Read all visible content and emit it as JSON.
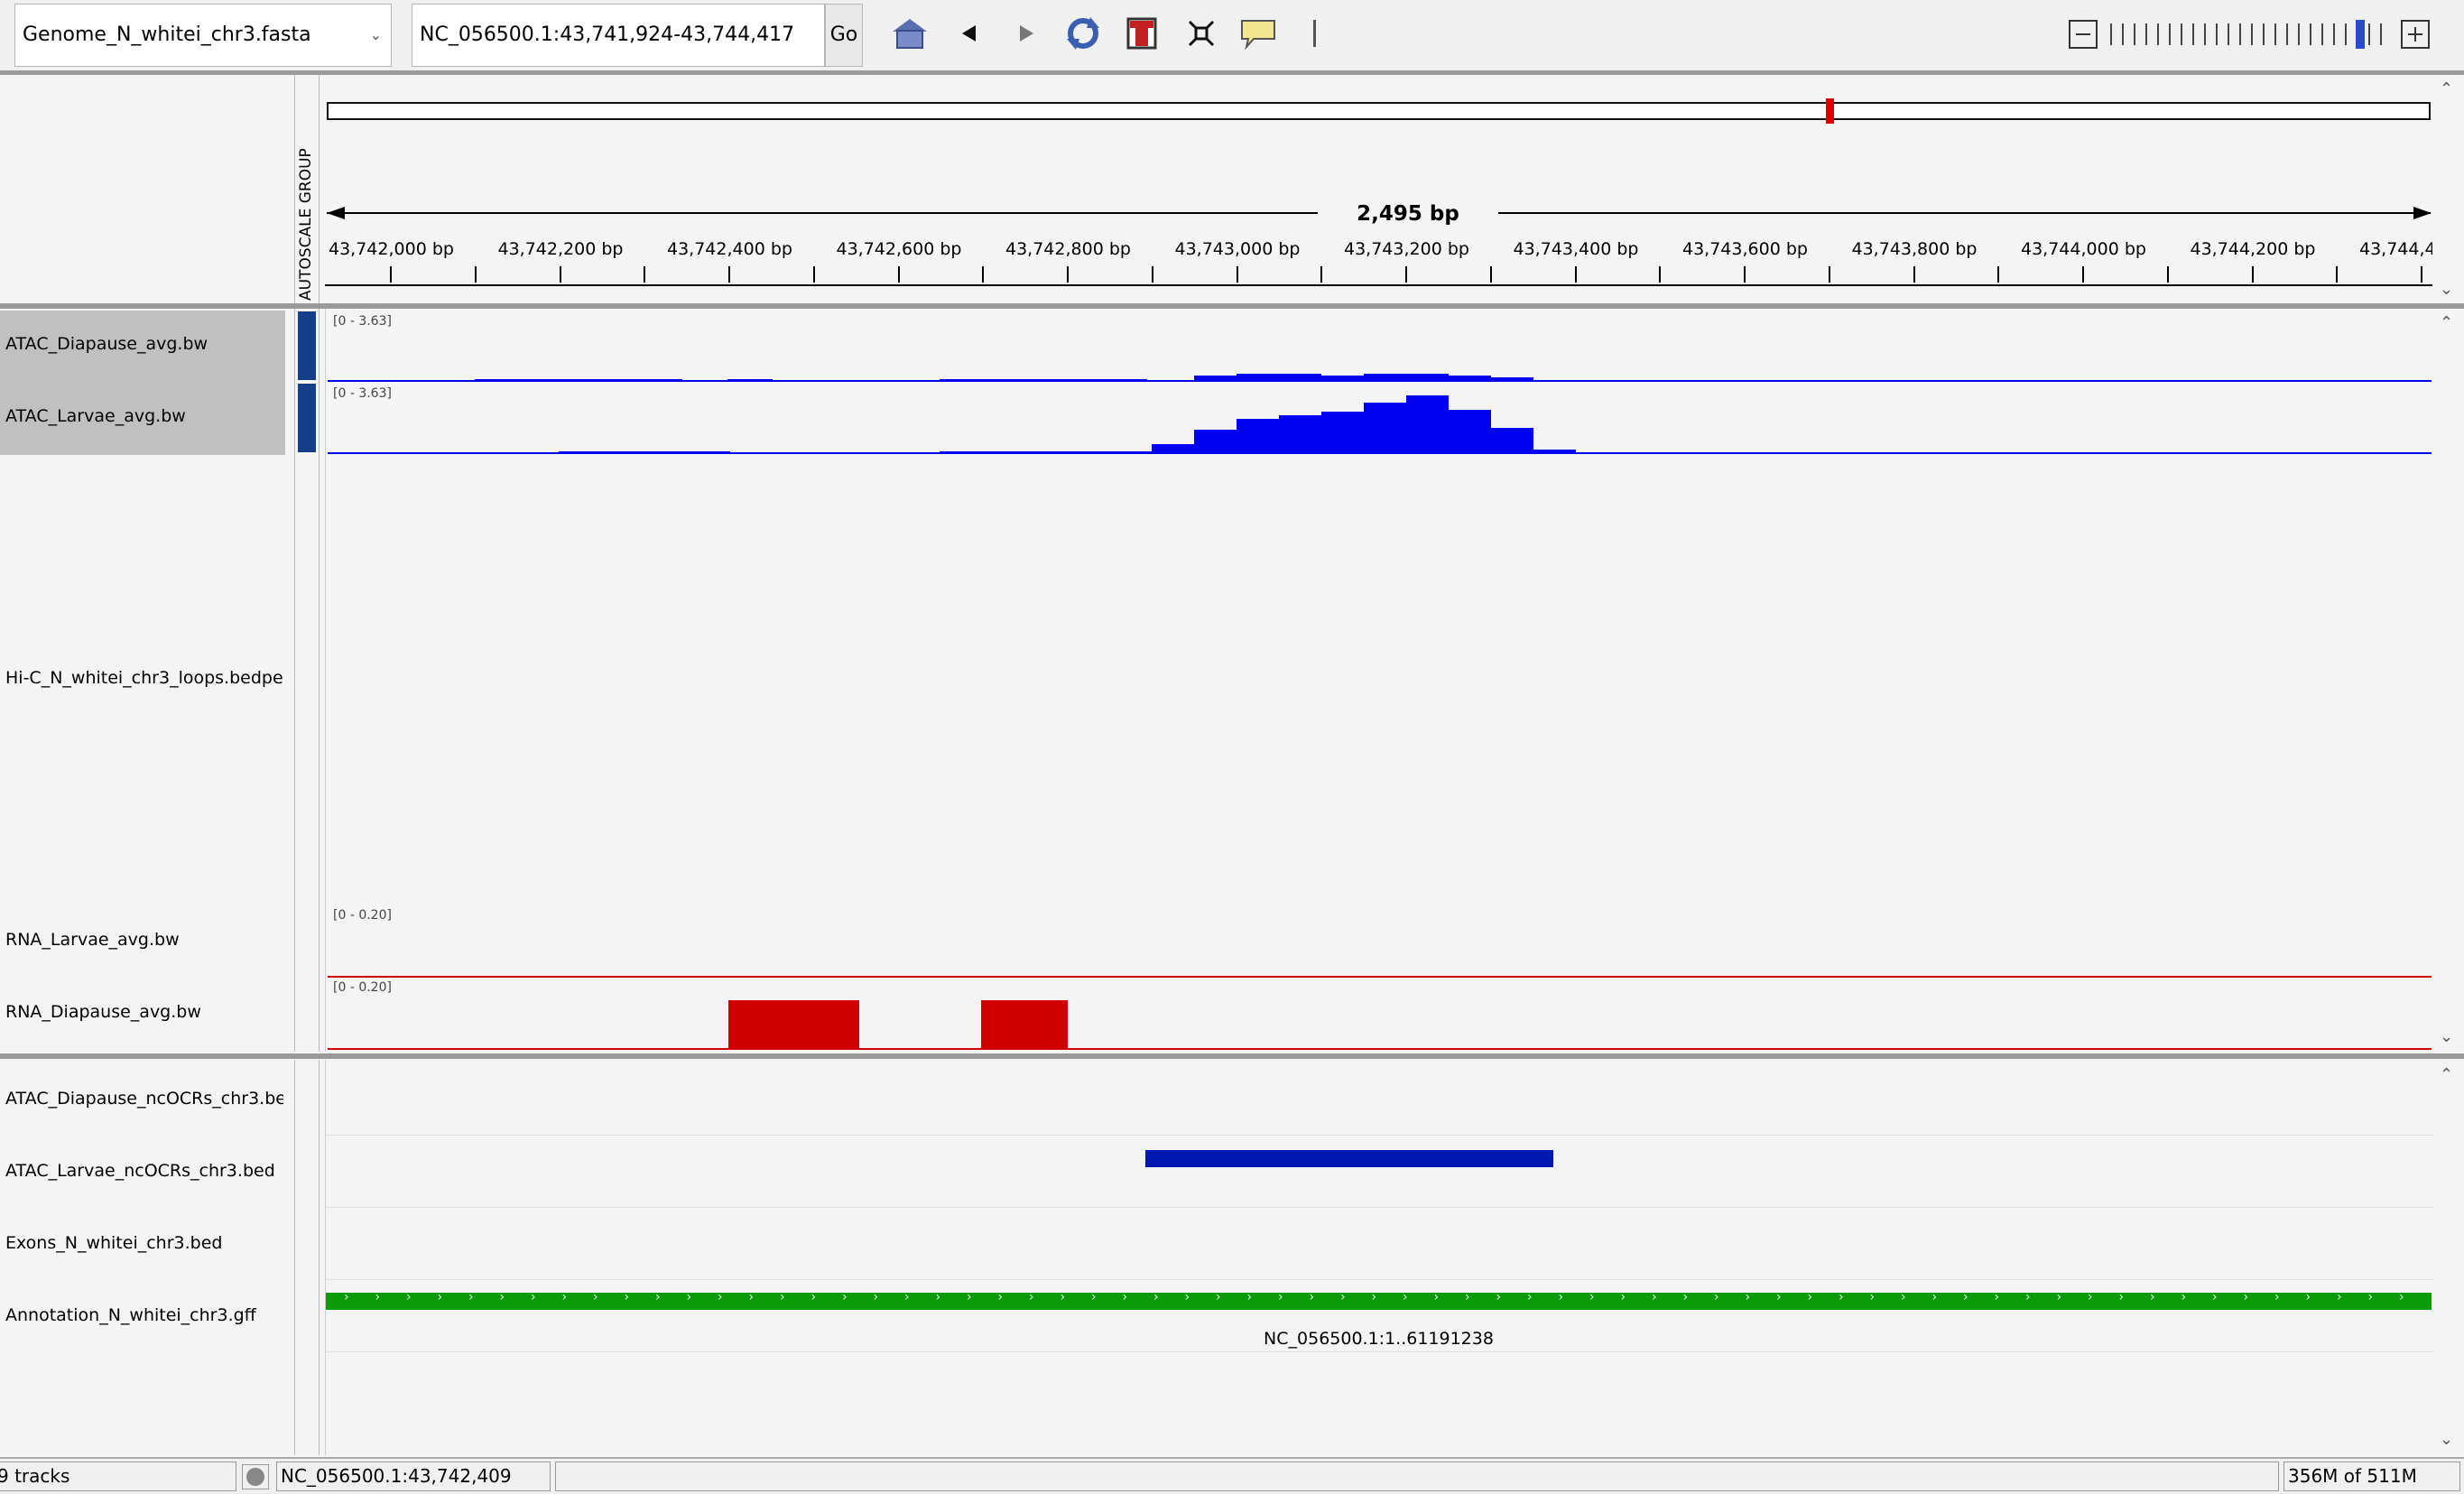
{
  "toolbar": {
    "genome": "Genome_N_whitei_chr3.fasta",
    "locus": "NC_056500.1:43,741,924-43,744,417",
    "go_label": "Go"
  },
  "ruler": {
    "span_label": "2,495 bp",
    "autoscale_label": "AUTOSCALE GROUP",
    "ticks": [
      "43,742,000 bp",
      "43,742,200 bp",
      "43,742,400 bp",
      "43,742,600 bp",
      "43,742,800 bp",
      "43,743,000 bp",
      "43,743,200 bp",
      "43,743,400 bp",
      "43,743,600 bp",
      "43,743,800 bp",
      "43,744,000 bp",
      "43,744,200 bp",
      "43,744,4("
    ]
  },
  "tracks": {
    "atac_diapause": {
      "name": "ATAC_Diapause_avg.bw",
      "range": "[0 - 3.63]"
    },
    "atac_larvae": {
      "name": "ATAC_Larvae_avg.bw",
      "range": "[0 - 3.63]"
    },
    "hic": {
      "name": "Hi-C_N_whitei_chr3_loops.bedpe"
    },
    "rna_larvae": {
      "name": "RNA_Larvae_avg.bw",
      "range": "[0 - 0.20]"
    },
    "rna_diapause": {
      "name": "RNA_Diapause_avg.bw",
      "range": "[0 - 0.20]"
    },
    "ocr_diapause": {
      "name": "ATAC_Diapause_ncOCRs_chr3.bed"
    },
    "ocr_larvae": {
      "name": "ATAC_Larvae_ncOCRs_chr3.bed"
    },
    "exons": {
      "name": "Exons_N_whitei_chr3.bed"
    },
    "annotation": {
      "name": "Annotation_N_whitei_chr3.gff",
      "feature_label": "NC_056500.1:1..61191238"
    }
  },
  "status": {
    "tracks": "9 tracks",
    "position": "NC_056500.1:43,742,409",
    "memory": "356M of 511M"
  },
  "colors": {
    "atac": "#0000f0",
    "rna": "#d00000",
    "ocr": "#0018b0",
    "annotation": "#0a9a0a",
    "selected_name_bg": "#c0c0c0"
  }
}
